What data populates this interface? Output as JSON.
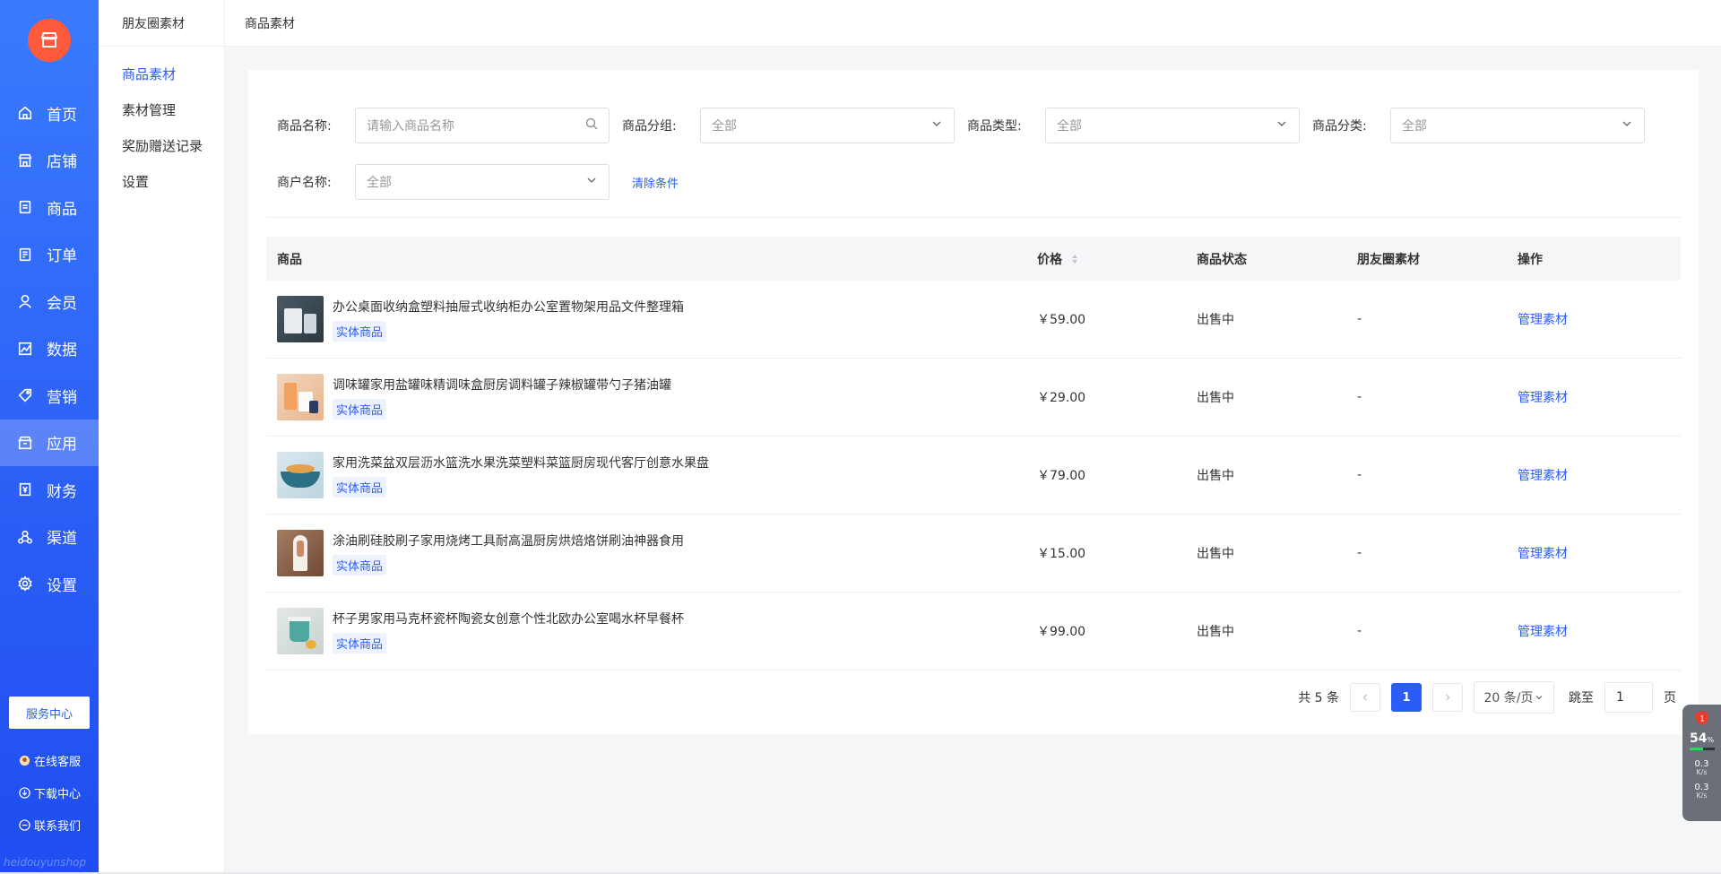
{
  "sidebar": {
    "logo_icon": "store-icon",
    "items": [
      {
        "label": "首页",
        "icon": "home-icon"
      },
      {
        "label": "店铺",
        "icon": "shop-icon"
      },
      {
        "label": "商品",
        "icon": "goods-icon"
      },
      {
        "label": "订单",
        "icon": "order-icon"
      },
      {
        "label": "会员",
        "icon": "user-icon"
      },
      {
        "label": "数据",
        "icon": "chart-icon"
      },
      {
        "label": "营销",
        "icon": "tag-icon"
      },
      {
        "label": "应用",
        "icon": "app-icon",
        "active": true
      },
      {
        "label": "财务",
        "icon": "finance-icon"
      },
      {
        "label": "渠道",
        "icon": "channel-icon"
      },
      {
        "label": "设置",
        "icon": "gear-icon"
      }
    ],
    "service_center": "服务中心",
    "bottom_links": [
      {
        "label": "在线客服",
        "icon": "chat-icon"
      },
      {
        "label": "下载中心",
        "icon": "download-icon"
      },
      {
        "label": "联系我们",
        "icon": "message-icon"
      }
    ],
    "watermark": "heidouyunshop"
  },
  "sub_sidebar": {
    "title": "朋友圈素材",
    "items": [
      {
        "label": "商品素材",
        "active": true
      },
      {
        "label": "素材管理"
      },
      {
        "label": "奖励赠送记录"
      },
      {
        "label": "设置"
      }
    ]
  },
  "topbar": {
    "title": "商品素材"
  },
  "filters": {
    "name_label": "商品名称:",
    "name_placeholder": "请输入商品名称",
    "group_label": "商品分组:",
    "group_value": "全部",
    "type_label": "商品类型:",
    "type_value": "全部",
    "category_label": "商品分类:",
    "category_value": "全部",
    "merchant_label": "商户名称:",
    "merchant_value": "全部",
    "clear_label": "清除条件"
  },
  "table": {
    "headers": {
      "product": "商品",
      "price": "价格",
      "status": "商品状态",
      "moment": "朋友圈素材",
      "op": "操作"
    },
    "rows": [
      {
        "name": "办公桌面收纳盒塑料抽屉式收纳柜办公室置物架用品文件整理箱",
        "tag": "实体商品",
        "price": "￥59.00",
        "status": "出售中",
        "moment": "-",
        "op": "管理素材"
      },
      {
        "name": "调味罐家用盐罐味精调味盒厨房调料罐子辣椒罐带勺子猪油罐",
        "tag": "实体商品",
        "price": "￥29.00",
        "status": "出售中",
        "moment": "-",
        "op": "管理素材"
      },
      {
        "name": "家用洗菜盆双层沥水篮洗水果洗菜塑料菜篮厨房现代客厅创意水果盘",
        "tag": "实体商品",
        "price": "￥79.00",
        "status": "出售中",
        "moment": "-",
        "op": "管理素材"
      },
      {
        "name": "涂油刷硅胶刷子家用烧烤工具耐高温厨房烘焙烙饼刷油神器食用",
        "tag": "实体商品",
        "price": "￥15.00",
        "status": "出售中",
        "moment": "-",
        "op": "管理素材"
      },
      {
        "name": "杯子男家用马克杯瓷杯陶瓷女创意个性北欧办公室喝水杯早餐杯",
        "tag": "实体商品",
        "price": "￥99.00",
        "status": "出售中",
        "moment": "-",
        "op": "管理素材"
      }
    ]
  },
  "pagination": {
    "total": "共 5 条",
    "current_page": "1",
    "page_size": "20 条/页",
    "jump_label": "跳至",
    "jump_value": "1",
    "page_suffix": "页"
  },
  "widget": {
    "badge": "1",
    "percent": "54",
    "percent_unit": "%",
    "cpu_fraction": 0.54,
    "up": "0.3",
    "up_unit": "K/s",
    "down": "0.3",
    "down_unit": "K/s"
  },
  "colors": {
    "primary": "#2a5df5",
    "logo": "#ff5a3c",
    "tag_bg": "#eef2ff"
  }
}
